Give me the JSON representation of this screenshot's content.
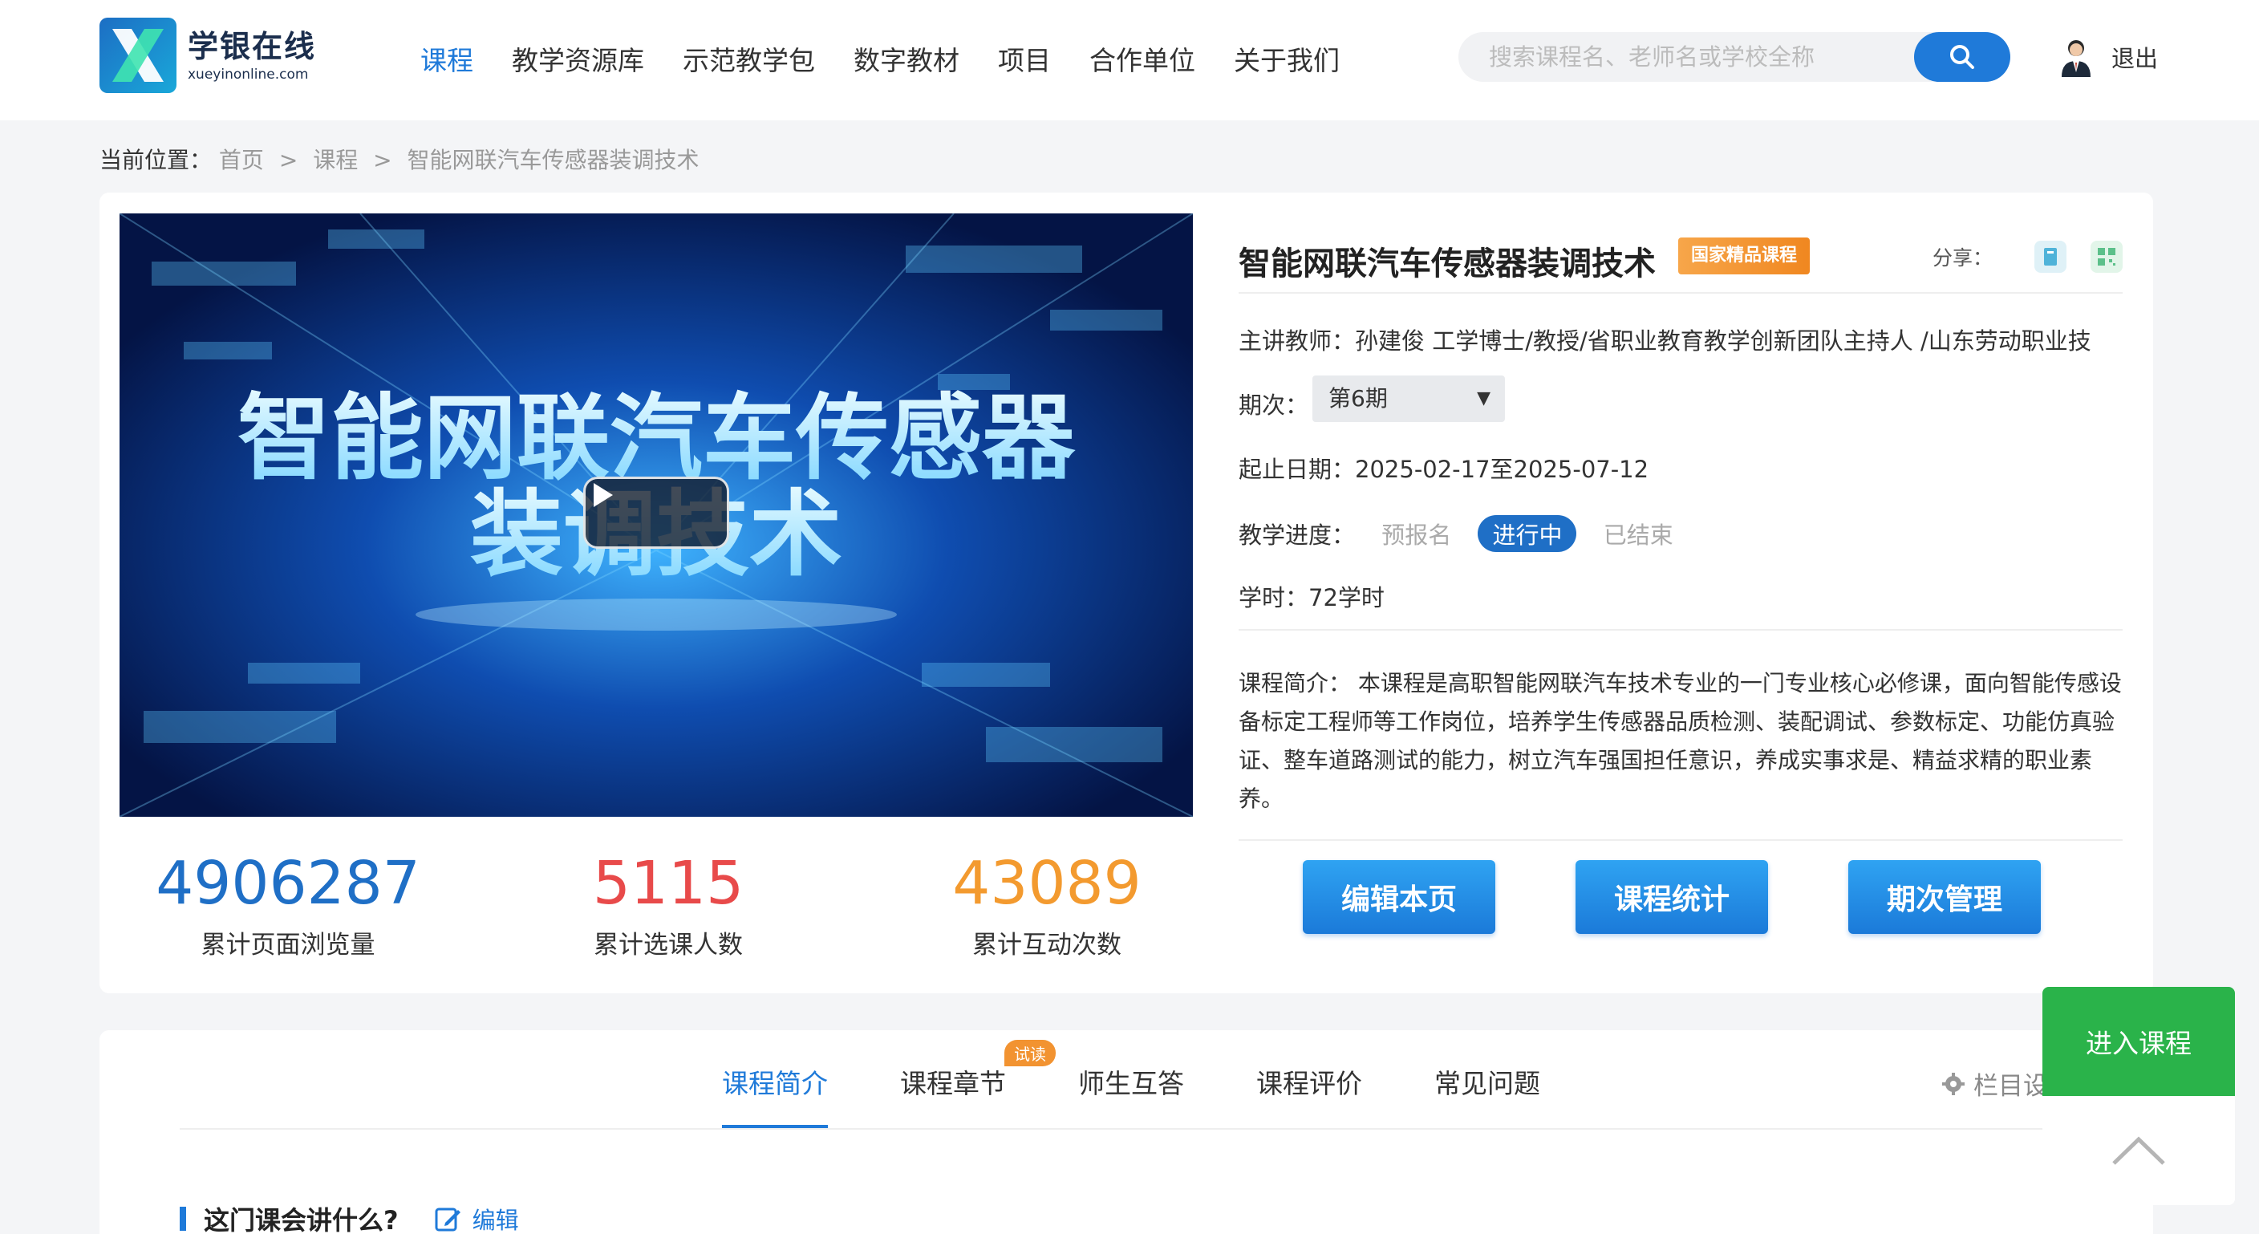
{
  "header": {
    "logo_cn": "学银在线",
    "logo_en": "xueyinonline.com",
    "nav": [
      {
        "label": "课程",
        "active": true
      },
      {
        "label": "教学资源库",
        "active": false
      },
      {
        "label": "示范教学包",
        "active": false
      },
      {
        "label": "数字教材",
        "active": false
      },
      {
        "label": "项目",
        "active": false
      },
      {
        "label": "合作单位",
        "active": false
      },
      {
        "label": "关于我们",
        "active": false
      }
    ],
    "search_placeholder": "搜索课程名、老师名或学校全称",
    "logout": "退出"
  },
  "breadcrumb": {
    "label": "当前位置：",
    "home": "首页",
    "courses": "课程",
    "current": "智能网联汽车传感器装调技术",
    "separator": ">"
  },
  "course": {
    "video_title_line1": "智能网联汽车传感器",
    "video_title_line2": "装调技术",
    "title": "智能网联汽车传感器装调技术",
    "badge": "国家精品课程",
    "share_label": "分享：",
    "teacher_label": "主讲教师：",
    "teacher": "孙建俊 工学博士/教授/省职业教育教学创新团队主持人 /山东劳动职业技",
    "term_label": "期次：",
    "term_value": "第6期",
    "date_label": "起止日期：",
    "date_value": "2025-02-17至2025-07-12",
    "progress_label": "教学进度：",
    "progress_options": [
      "预报名",
      "进行中",
      "已结束"
    ],
    "progress_active": "进行中",
    "hours_label": "学时：",
    "hours_value": "72学时",
    "intro_label": "课程简介：",
    "intro": "本课程是高职智能网联汽车技术专业的一门专业核心必修课，面向智能传感设备标定工程师等工作岗位，培养学生传感器品质检测、装配调试、参数标定、功能仿真验证、整车道路测试的能力，树立汽车强国担任意识，养成实事求是、精益求精的职业素养。"
  },
  "stats": [
    {
      "value": "4906287",
      "label": "累计页面浏览量",
      "color": "#1f6fc6"
    },
    {
      "value": "5115",
      "label": "累计选课人数",
      "color": "#e84a4a"
    },
    {
      "value": "43089",
      "label": "累计互动次数",
      "color": "#f39a2f"
    }
  ],
  "actions": [
    "编辑本页",
    "课程统计",
    "期次管理"
  ],
  "tabs": [
    {
      "label": "课程简介",
      "active": true
    },
    {
      "label": "课程章节",
      "active": false,
      "badge": "试读"
    },
    {
      "label": "师生互答",
      "active": false
    },
    {
      "label": "课程评价",
      "active": false
    },
    {
      "label": "常见问题",
      "active": false
    }
  ],
  "column_settings": "栏目设",
  "section": {
    "title": "这门课会讲什么?",
    "edit": "编辑"
  },
  "float": {
    "enter_course": "进入课程"
  },
  "colors": {
    "primary": "#1f7ad9",
    "green": "#2ab34a",
    "badge_orange": "#f08720"
  }
}
